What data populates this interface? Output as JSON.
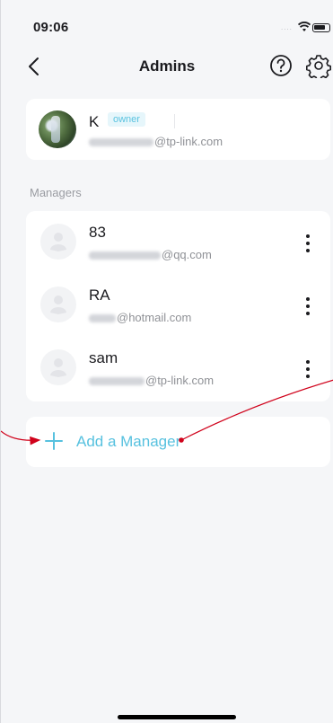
{
  "status_bar": {
    "time": "09:06",
    "signal": "....",
    "icons": [
      "wifi-icon",
      "battery-icon"
    ]
  },
  "nav": {
    "title": "Admins",
    "icons": [
      "back-icon",
      "help-icon",
      "settings-icon"
    ]
  },
  "owner": {
    "name": "K",
    "badge": "owner",
    "email_domain": "@tp-link.com"
  },
  "managers_label": "Managers",
  "managers": [
    {
      "name": "83",
      "email_domain": "@qq.com"
    },
    {
      "name": "RA",
      "email_domain": "@hotmail.com"
    },
    {
      "name": "sam",
      "email_domain": "@tp-link.com"
    }
  ],
  "add_manager": {
    "label": "Add a Manager",
    "icon": "plus-icon"
  },
  "colors": {
    "accent": "#57c1df",
    "annotation": "#d0021b",
    "background": "#f5f6f8"
  }
}
